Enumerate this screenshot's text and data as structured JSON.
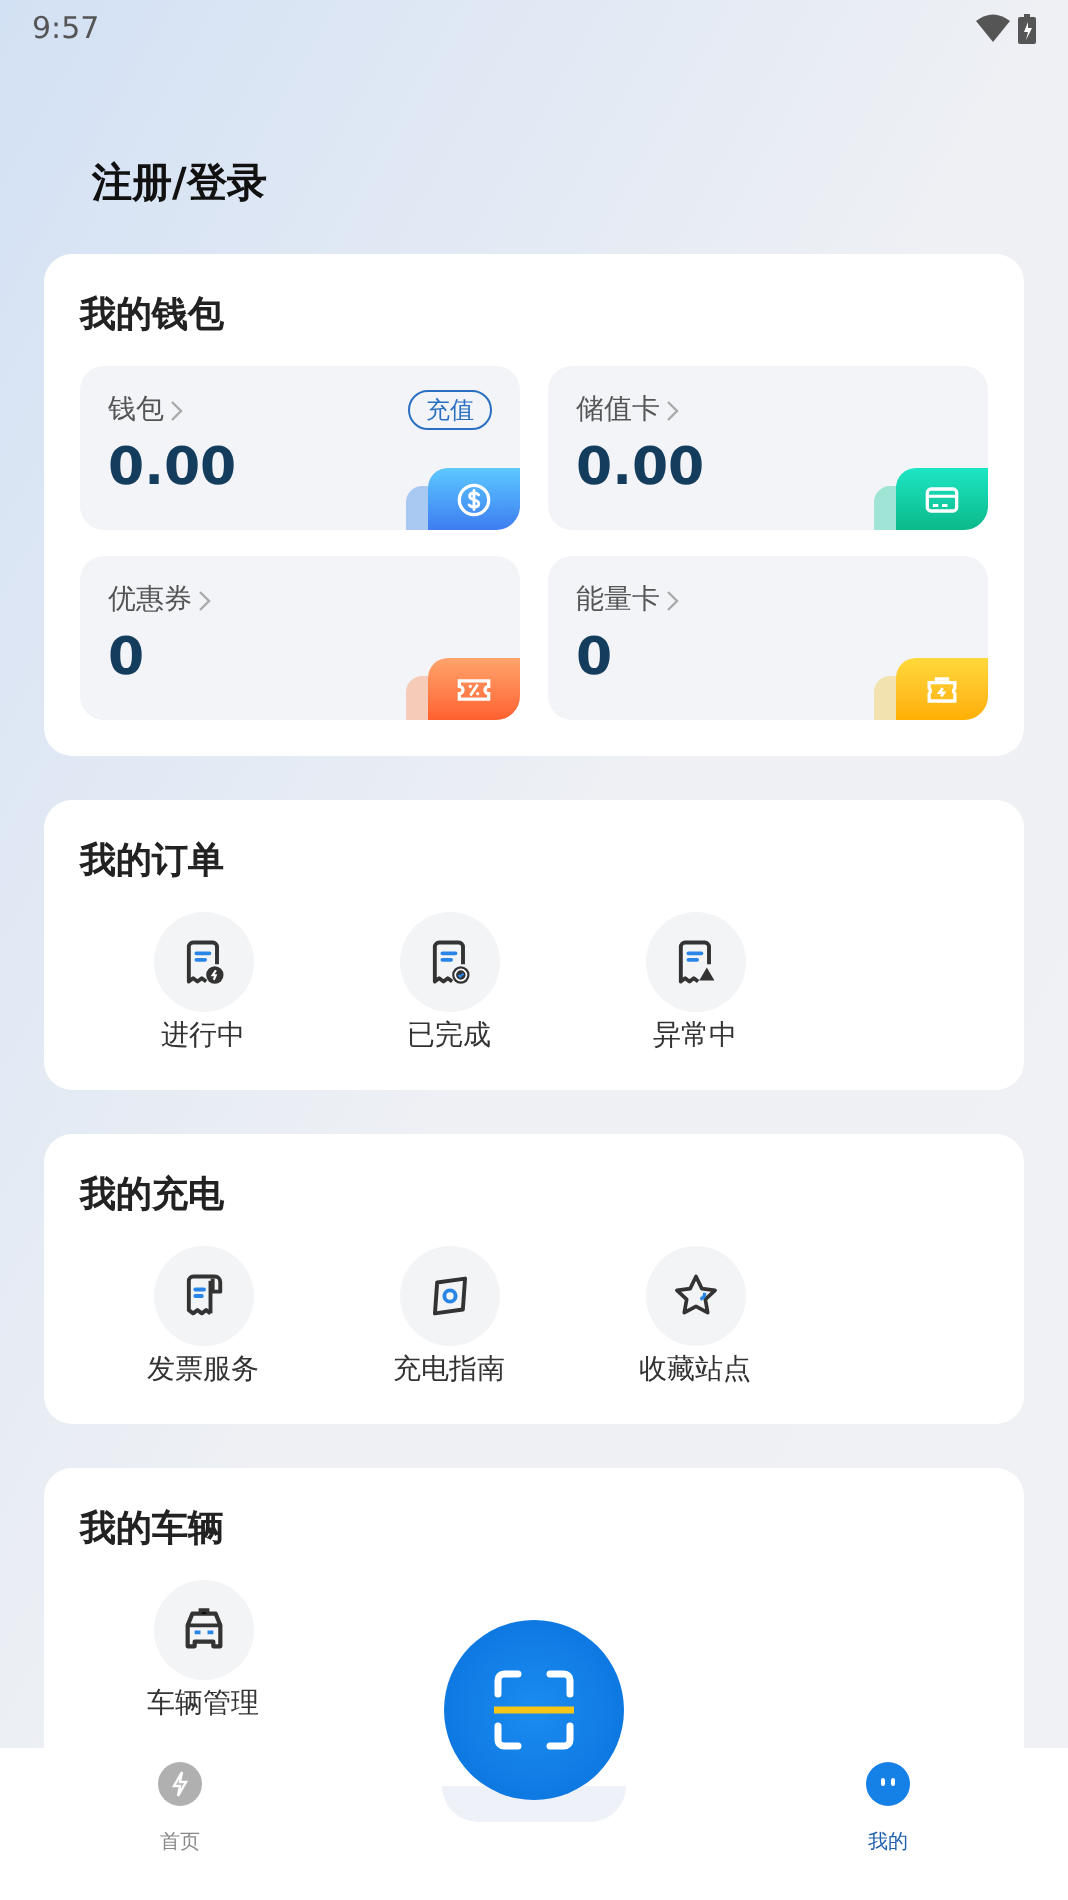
{
  "status_bar": {
    "time": "9:57"
  },
  "header": {
    "title": "注册/登录"
  },
  "wallet": {
    "title": "我的钱包",
    "tiles": [
      {
        "label": "钱包",
        "value": "0.00",
        "action": "充值",
        "kind": "money"
      },
      {
        "label": "储值卡",
        "value": "0.00",
        "kind": "card"
      },
      {
        "label": "优惠券",
        "value": "0",
        "kind": "coupon"
      },
      {
        "label": "能量卡",
        "value": "0",
        "kind": "energy"
      }
    ]
  },
  "sections": [
    {
      "title": "我的订单",
      "items": [
        {
          "label": "进行中",
          "kind": "order-progress"
        },
        {
          "label": "已完成",
          "kind": "order-done"
        },
        {
          "label": "异常中",
          "kind": "order-error"
        }
      ]
    },
    {
      "title": "我的充电",
      "items": [
        {
          "label": "发票服务",
          "kind": "invoice"
        },
        {
          "label": "充电指南",
          "kind": "guide"
        },
        {
          "label": "收藏站点",
          "kind": "star"
        }
      ]
    },
    {
      "title": "我的车辆",
      "items": [
        {
          "label": "车辆管理",
          "kind": "car"
        }
      ]
    }
  ],
  "bottom_nav": {
    "items": [
      {
        "label": "首页",
        "selected": false
      },
      {
        "label": "我的",
        "selected": true
      }
    ]
  }
}
